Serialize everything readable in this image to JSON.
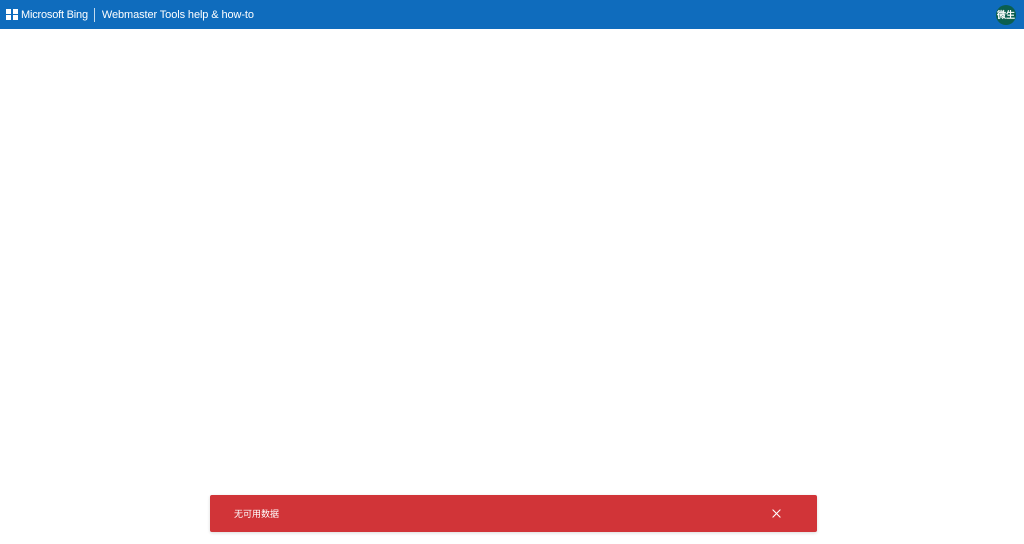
{
  "header": {
    "brand": "Microsoft Bing",
    "product_title": "Webmaster Tools help & how-to",
    "avatar_text": "微生",
    "background_color": "#0f6cbd",
    "avatar_color": "#0b5f4f",
    "icons": {
      "logo": "windows-logo-icon"
    }
  },
  "toast": {
    "message": "无可用数据",
    "background_color": "#d13438",
    "icons": {
      "close": "close-icon"
    }
  }
}
